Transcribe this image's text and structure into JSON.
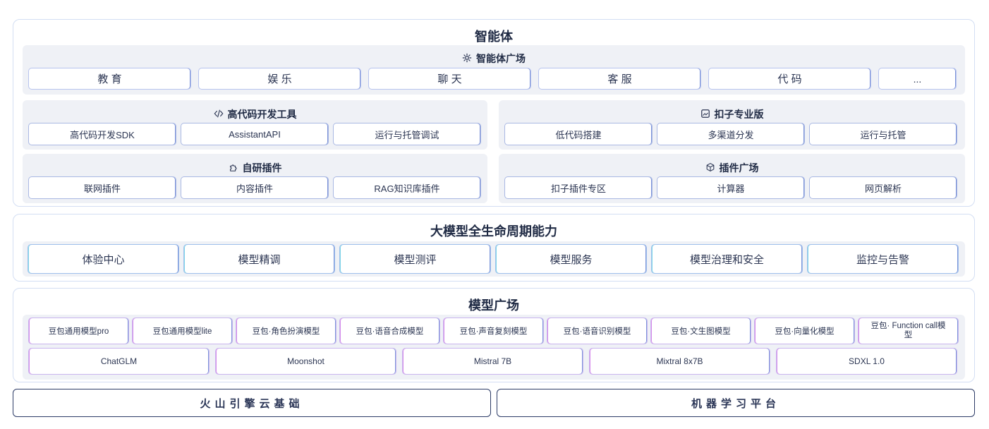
{
  "agent": {
    "title": "智能体",
    "plaza": {
      "title": "智能体广场",
      "icon": "gear-icon",
      "items": [
        "教 育",
        "娱 乐",
        "聊 天",
        "客 服",
        "代 码",
        "..."
      ]
    },
    "high_code": {
      "title": "高代码开发工具",
      "icon": "code-icon",
      "items": [
        "高代码开发SDK",
        "AssistantAPI",
        "运行与托管调试"
      ]
    },
    "coze_pro": {
      "title": "扣子专业版",
      "icon": "image-icon",
      "items": [
        "低代码搭建",
        "多渠道分发",
        "运行与托管"
      ]
    },
    "self_plugins": {
      "title": "自研插件",
      "icon": "puzzle-icon",
      "items": [
        "联网插件",
        "内容插件",
        "RAG知识库插件"
      ]
    },
    "plugin_plaza": {
      "title": "插件广场",
      "icon": "cube-icon",
      "items": [
        "扣子插件专区",
        "计算器",
        "网页解析"
      ]
    }
  },
  "lifecycle": {
    "title": "大模型全生命周期能力",
    "items": [
      "体验中心",
      "模型精调",
      "模型测评",
      "模型服务",
      "模型治理和安全",
      "监控与告警"
    ]
  },
  "models": {
    "title": "模型广场",
    "row1": [
      "豆包通用模型pro",
      "豆包通用模型lite",
      "豆包·角色扮演模型",
      "豆包·语音合成模型",
      "豆包·声音复刻模型",
      "豆包·语音识别模型",
      "豆包·文生图模型",
      "豆包·向量化模型",
      "豆包· Function call模型"
    ],
    "row2": [
      "ChatGLM",
      "Moonshot",
      "Mistral 7B",
      "Mixtral 8x7B",
      "SDXL 1.0"
    ]
  },
  "foundation": {
    "left": "火山引擎云基础",
    "right": "机器学习平台"
  },
  "colors": {
    "accent_blue": "#7c93d8",
    "accent_teal": "#7fd6e8",
    "accent_violet": "#d68bea",
    "panel_bg": "#eff1f6"
  }
}
